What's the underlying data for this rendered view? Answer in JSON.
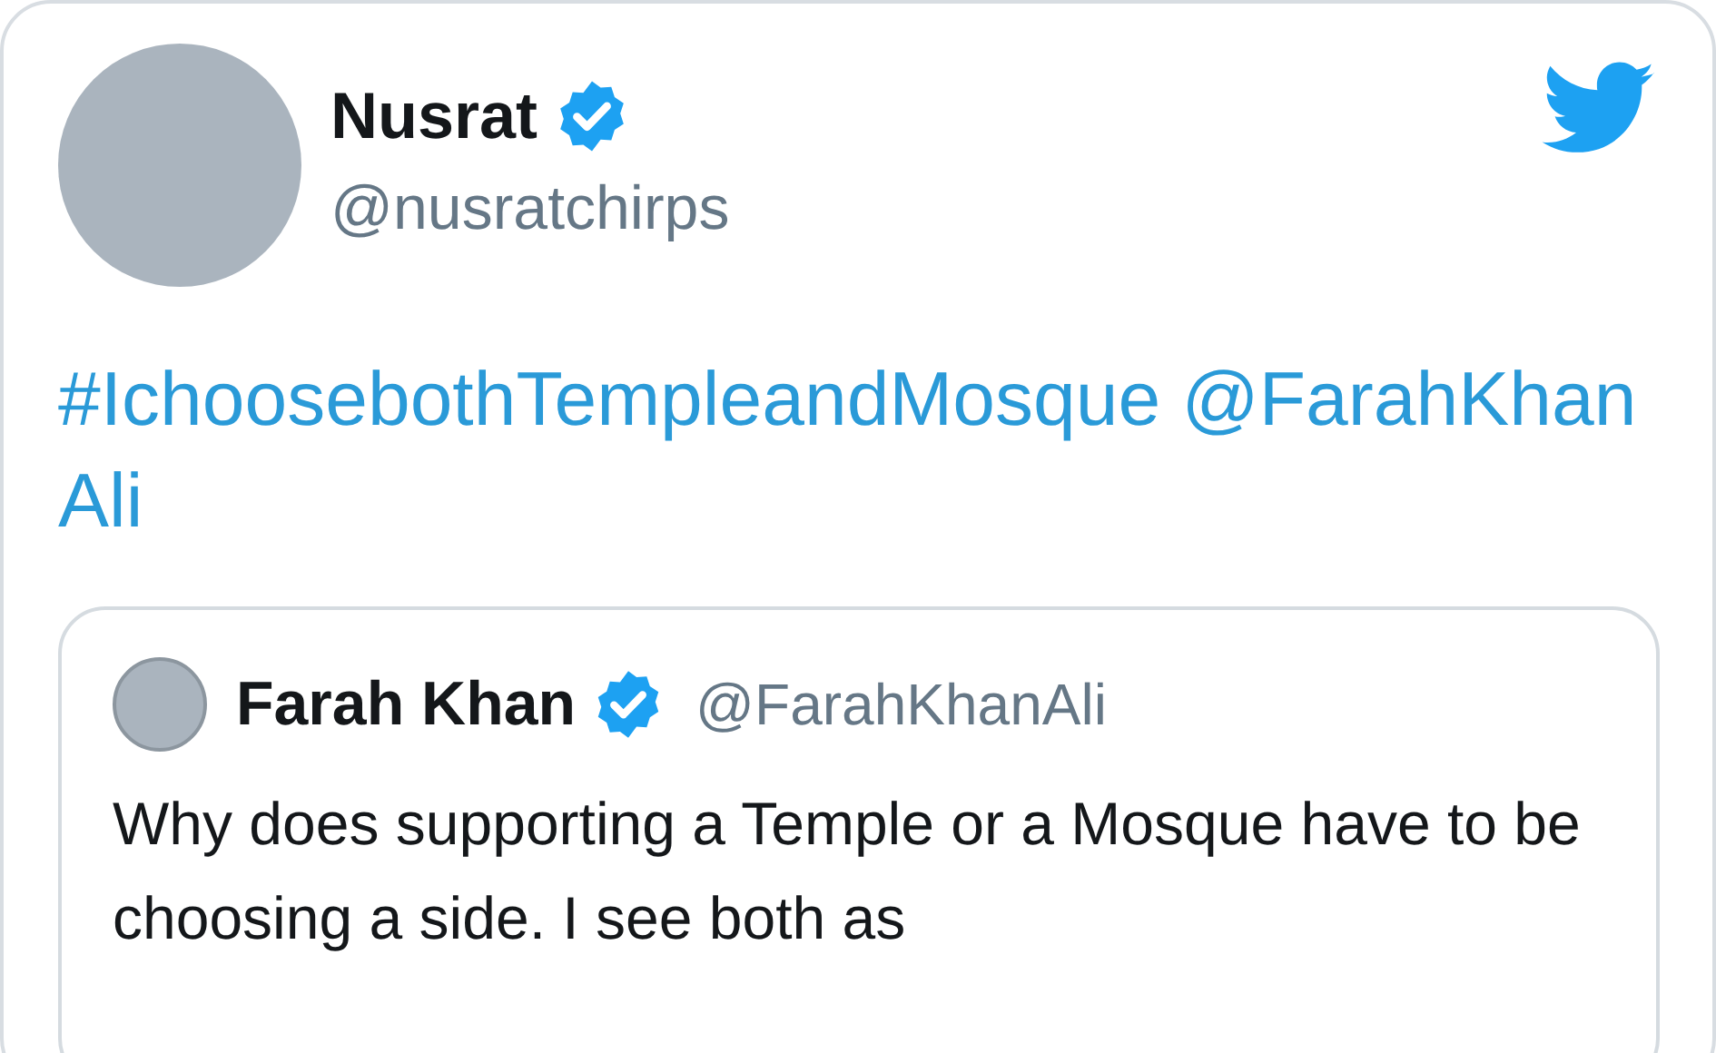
{
  "tweet": {
    "name": "Nusrat",
    "verified": true,
    "handle": "@nusratchirps",
    "text": "#IchoosebothTempleandMosque @FarahKhanAli",
    "quoted": {
      "name": "Farah Khan",
      "verified": true,
      "handle": "@FarahKhanAli",
      "text": "Why does supporting a Temple or a Mosque have to be choosing a side. I see both as"
    }
  }
}
